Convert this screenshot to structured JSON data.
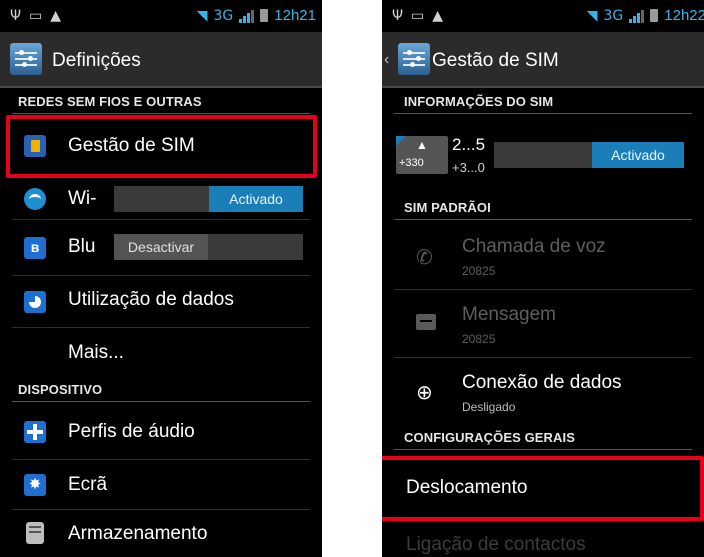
{
  "left": {
    "status": {
      "network": "3G",
      "time": "12h21"
    },
    "title": "Definições",
    "sections": {
      "wireless": "REDES SEM FIOS E OUTRAS",
      "device": "DISPOSITIVO"
    },
    "items": {
      "sim": "Gestão de SIM",
      "wifi": "Wi-",
      "wifi_toggle": "Activado",
      "bluetooth": "Blu",
      "bluetooth_toggle": "Desactivar",
      "data_usage": "Utilização de dados",
      "more": "Mais...",
      "audio": "Perfis de áudio",
      "display": "Ecrã",
      "storage": "Armazenamento"
    }
  },
  "right": {
    "status": {
      "network": "3G",
      "time": "12h22"
    },
    "title": "Gestão de SIM",
    "sections": {
      "info": "INFORMAÇÕES DO SIM",
      "default": "SIM PADRÃOI",
      "general": "CONFIGURAÇÕES GERAIS"
    },
    "sim_card": {
      "name": "2...5",
      "number": "+3...0",
      "prefix": "+330",
      "toggle": "Activado"
    },
    "items": {
      "voice_call": "Chamada de voz",
      "voice_call_value": "20825",
      "message": "Mensagem",
      "message_value": "20825",
      "data_connection": "Conexão de dados",
      "data_connection_value": "Desligado",
      "roaming": "Deslocamento",
      "contacts_link": "Ligação de contactos"
    }
  },
  "colors": {
    "accent": "#39b3e6",
    "toggle_on": "#1a7fb8",
    "highlight": "#e6001a"
  },
  "icons": {
    "status_usb": "usb-icon",
    "status_screenshot": "image-icon",
    "status_warning": "warning-icon",
    "status_wifi": "wifi-icon",
    "status_battery": "battery-icon"
  }
}
